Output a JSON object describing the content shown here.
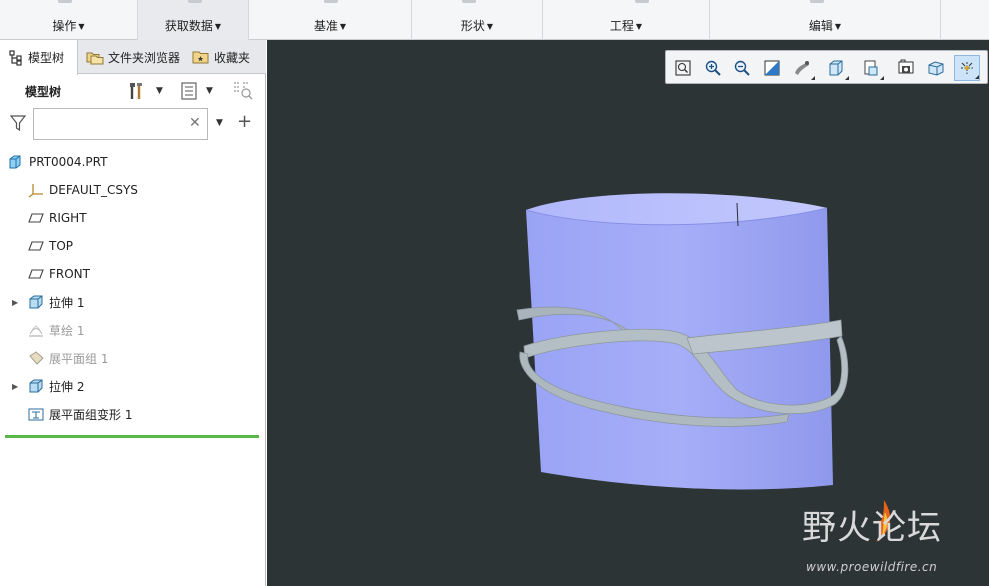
{
  "ribbon": {
    "groups": [
      {
        "label": "操作"
      },
      {
        "label": "获取数据"
      },
      {
        "label": "基准"
      },
      {
        "label": "形状"
      },
      {
        "label": "工程"
      },
      {
        "label": "编辑"
      }
    ],
    "active_group": "获取数据"
  },
  "panel": {
    "tabs": [
      {
        "label": "模型树",
        "icon": "model-tree-icon",
        "active": true
      },
      {
        "label": "文件夹浏览器",
        "icon": "folder-browser-icon",
        "active": false
      },
      {
        "label": "收藏夹",
        "icon": "favorites-icon",
        "active": false
      }
    ],
    "tree_title": "模型树",
    "header_buttons": [
      "settings-tools-icon",
      "show-options-icon",
      "tree-filter-icon"
    ],
    "filter": {
      "value": "",
      "placeholder": ""
    },
    "tree": [
      {
        "label": "PRT0004.PRT",
        "icon": "part-icon",
        "expandable": false,
        "dimmed": false,
        "indent": 0
      },
      {
        "label": "DEFAULT_CSYS",
        "icon": "csys-icon",
        "expandable": false,
        "dimmed": false,
        "indent": 1
      },
      {
        "label": "RIGHT",
        "icon": "datum-plane-icon",
        "expandable": false,
        "dimmed": false,
        "indent": 1
      },
      {
        "label": "TOP",
        "icon": "datum-plane-icon",
        "expandable": false,
        "dimmed": false,
        "indent": 1
      },
      {
        "label": "FRONT",
        "icon": "datum-plane-icon",
        "expandable": false,
        "dimmed": false,
        "indent": 1
      },
      {
        "label": "拉伸 1",
        "icon": "extrude-icon",
        "expandable": true,
        "dimmed": false,
        "indent": 1
      },
      {
        "label": "草绘 1",
        "icon": "sketch-icon",
        "expandable": false,
        "dimmed": true,
        "indent": 1
      },
      {
        "label": "展平面组 1",
        "icon": "flatten-quilt-icon",
        "expandable": false,
        "dimmed": true,
        "indent": 1
      },
      {
        "label": "拉伸 2",
        "icon": "extrude-icon",
        "expandable": true,
        "dimmed": false,
        "indent": 1
      },
      {
        "label": "展平面组变形 1",
        "icon": "flatten-deform-icon",
        "expandable": false,
        "dimmed": false,
        "indent": 1
      }
    ]
  },
  "view_toolbar": {
    "buttons": [
      {
        "icon": "refit-icon"
      },
      {
        "icon": "zoom-in-icon"
      },
      {
        "icon": "zoom-out-icon"
      },
      {
        "icon": "repaint-icon"
      },
      {
        "icon": "display-style-icon"
      },
      {
        "icon": "saved-orientations-icon"
      },
      {
        "icon": "view-manager-icon"
      },
      {
        "icon": "perspective-view-icon"
      },
      {
        "icon": "datum-display-icon"
      },
      {
        "icon": "spin-center-icon",
        "active": true
      }
    ]
  },
  "colors": {
    "viewport_bg": "#2d3436",
    "model_surface": "#a3acf7",
    "model_band": "#b8c2c9",
    "insert_line": "#58b847"
  },
  "watermark": {
    "text": "野火论坛",
    "url": "www.proewildfire.cn"
  }
}
